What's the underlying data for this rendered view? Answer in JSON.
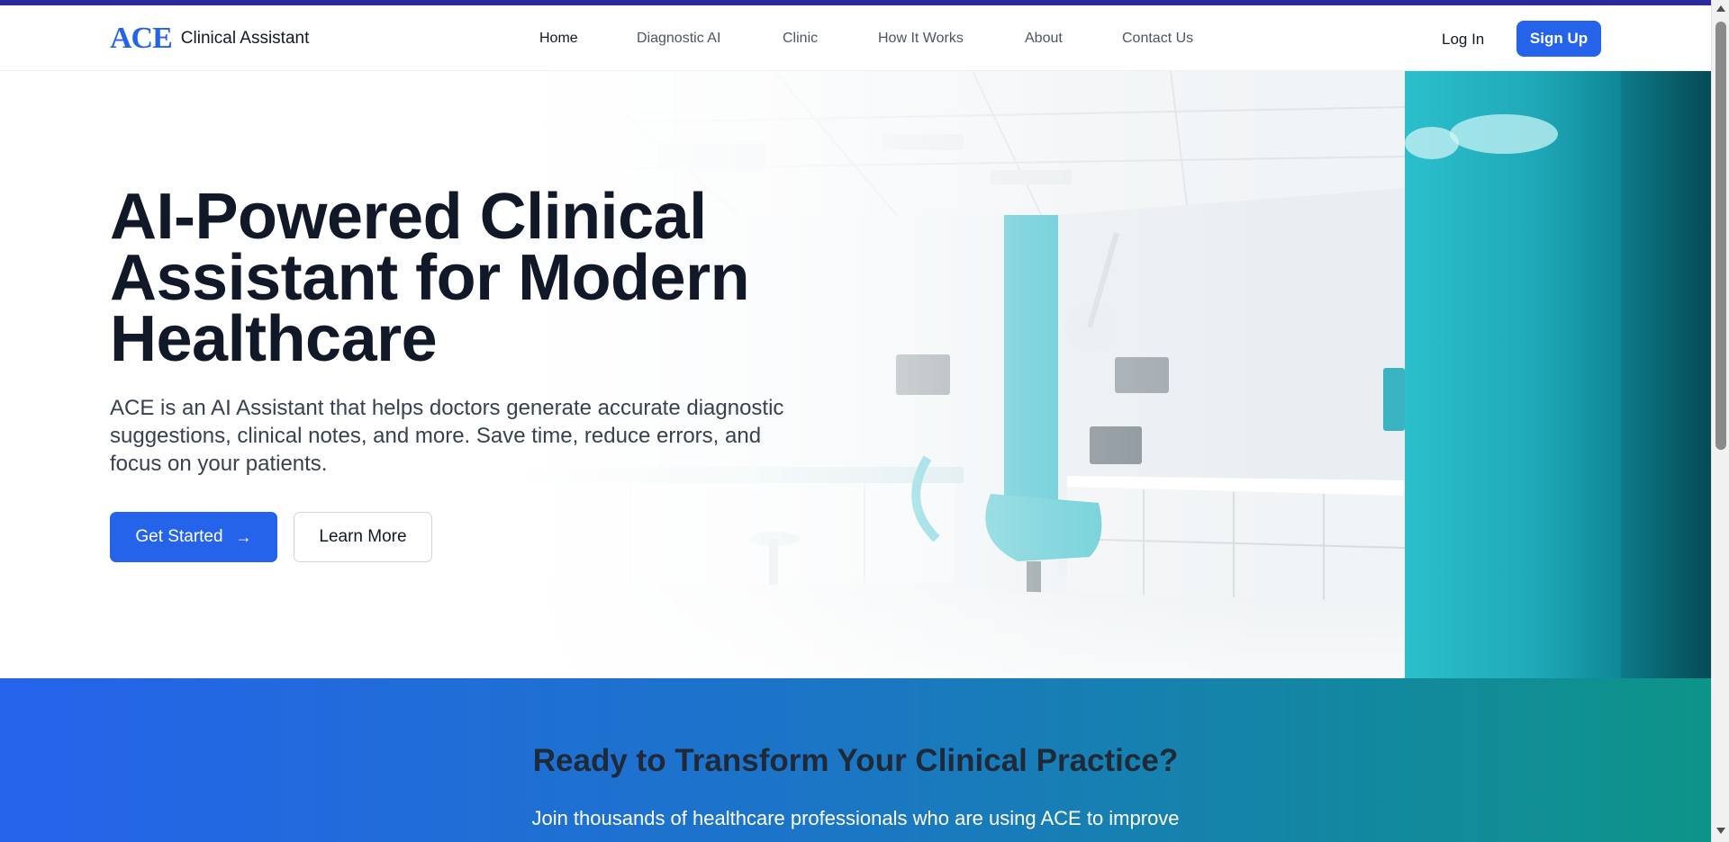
{
  "header": {
    "logo_text": "ACE",
    "brand_name": "Clinical Assistant",
    "nav": [
      {
        "label": "Home",
        "active": true
      },
      {
        "label": "Diagnostic AI",
        "active": false
      },
      {
        "label": "Clinic",
        "active": false
      },
      {
        "label": "How It Works",
        "active": false
      },
      {
        "label": "About",
        "active": false
      },
      {
        "label": "Contact Us",
        "active": false
      }
    ],
    "login_label": "Log In",
    "signup_label": "Sign Up"
  },
  "hero": {
    "title_line1": "AI-Powered Clinical",
    "title_line2": "Assistant for Modern",
    "title_line3": "Healthcare",
    "description": "ACE is an AI Assistant that helps doctors generate accurate diagnostic suggestions, clinical notes, and more. Save time, reduce errors, and focus on your patients.",
    "primary_button": "Get Started",
    "primary_button_icon": "arrow-right-icon",
    "secondary_button": "Learn More",
    "image_icon": "clinic-room-image"
  },
  "cta": {
    "title": "Ready to Transform Your Clinical Practice?",
    "text": "Join thousands of healthcare professionals who are using ACE to improve"
  },
  "colors": {
    "accent": "#2563eb",
    "topbar": "#2d2a9e",
    "teal": "#0d9488",
    "text_dark": "#111827"
  }
}
